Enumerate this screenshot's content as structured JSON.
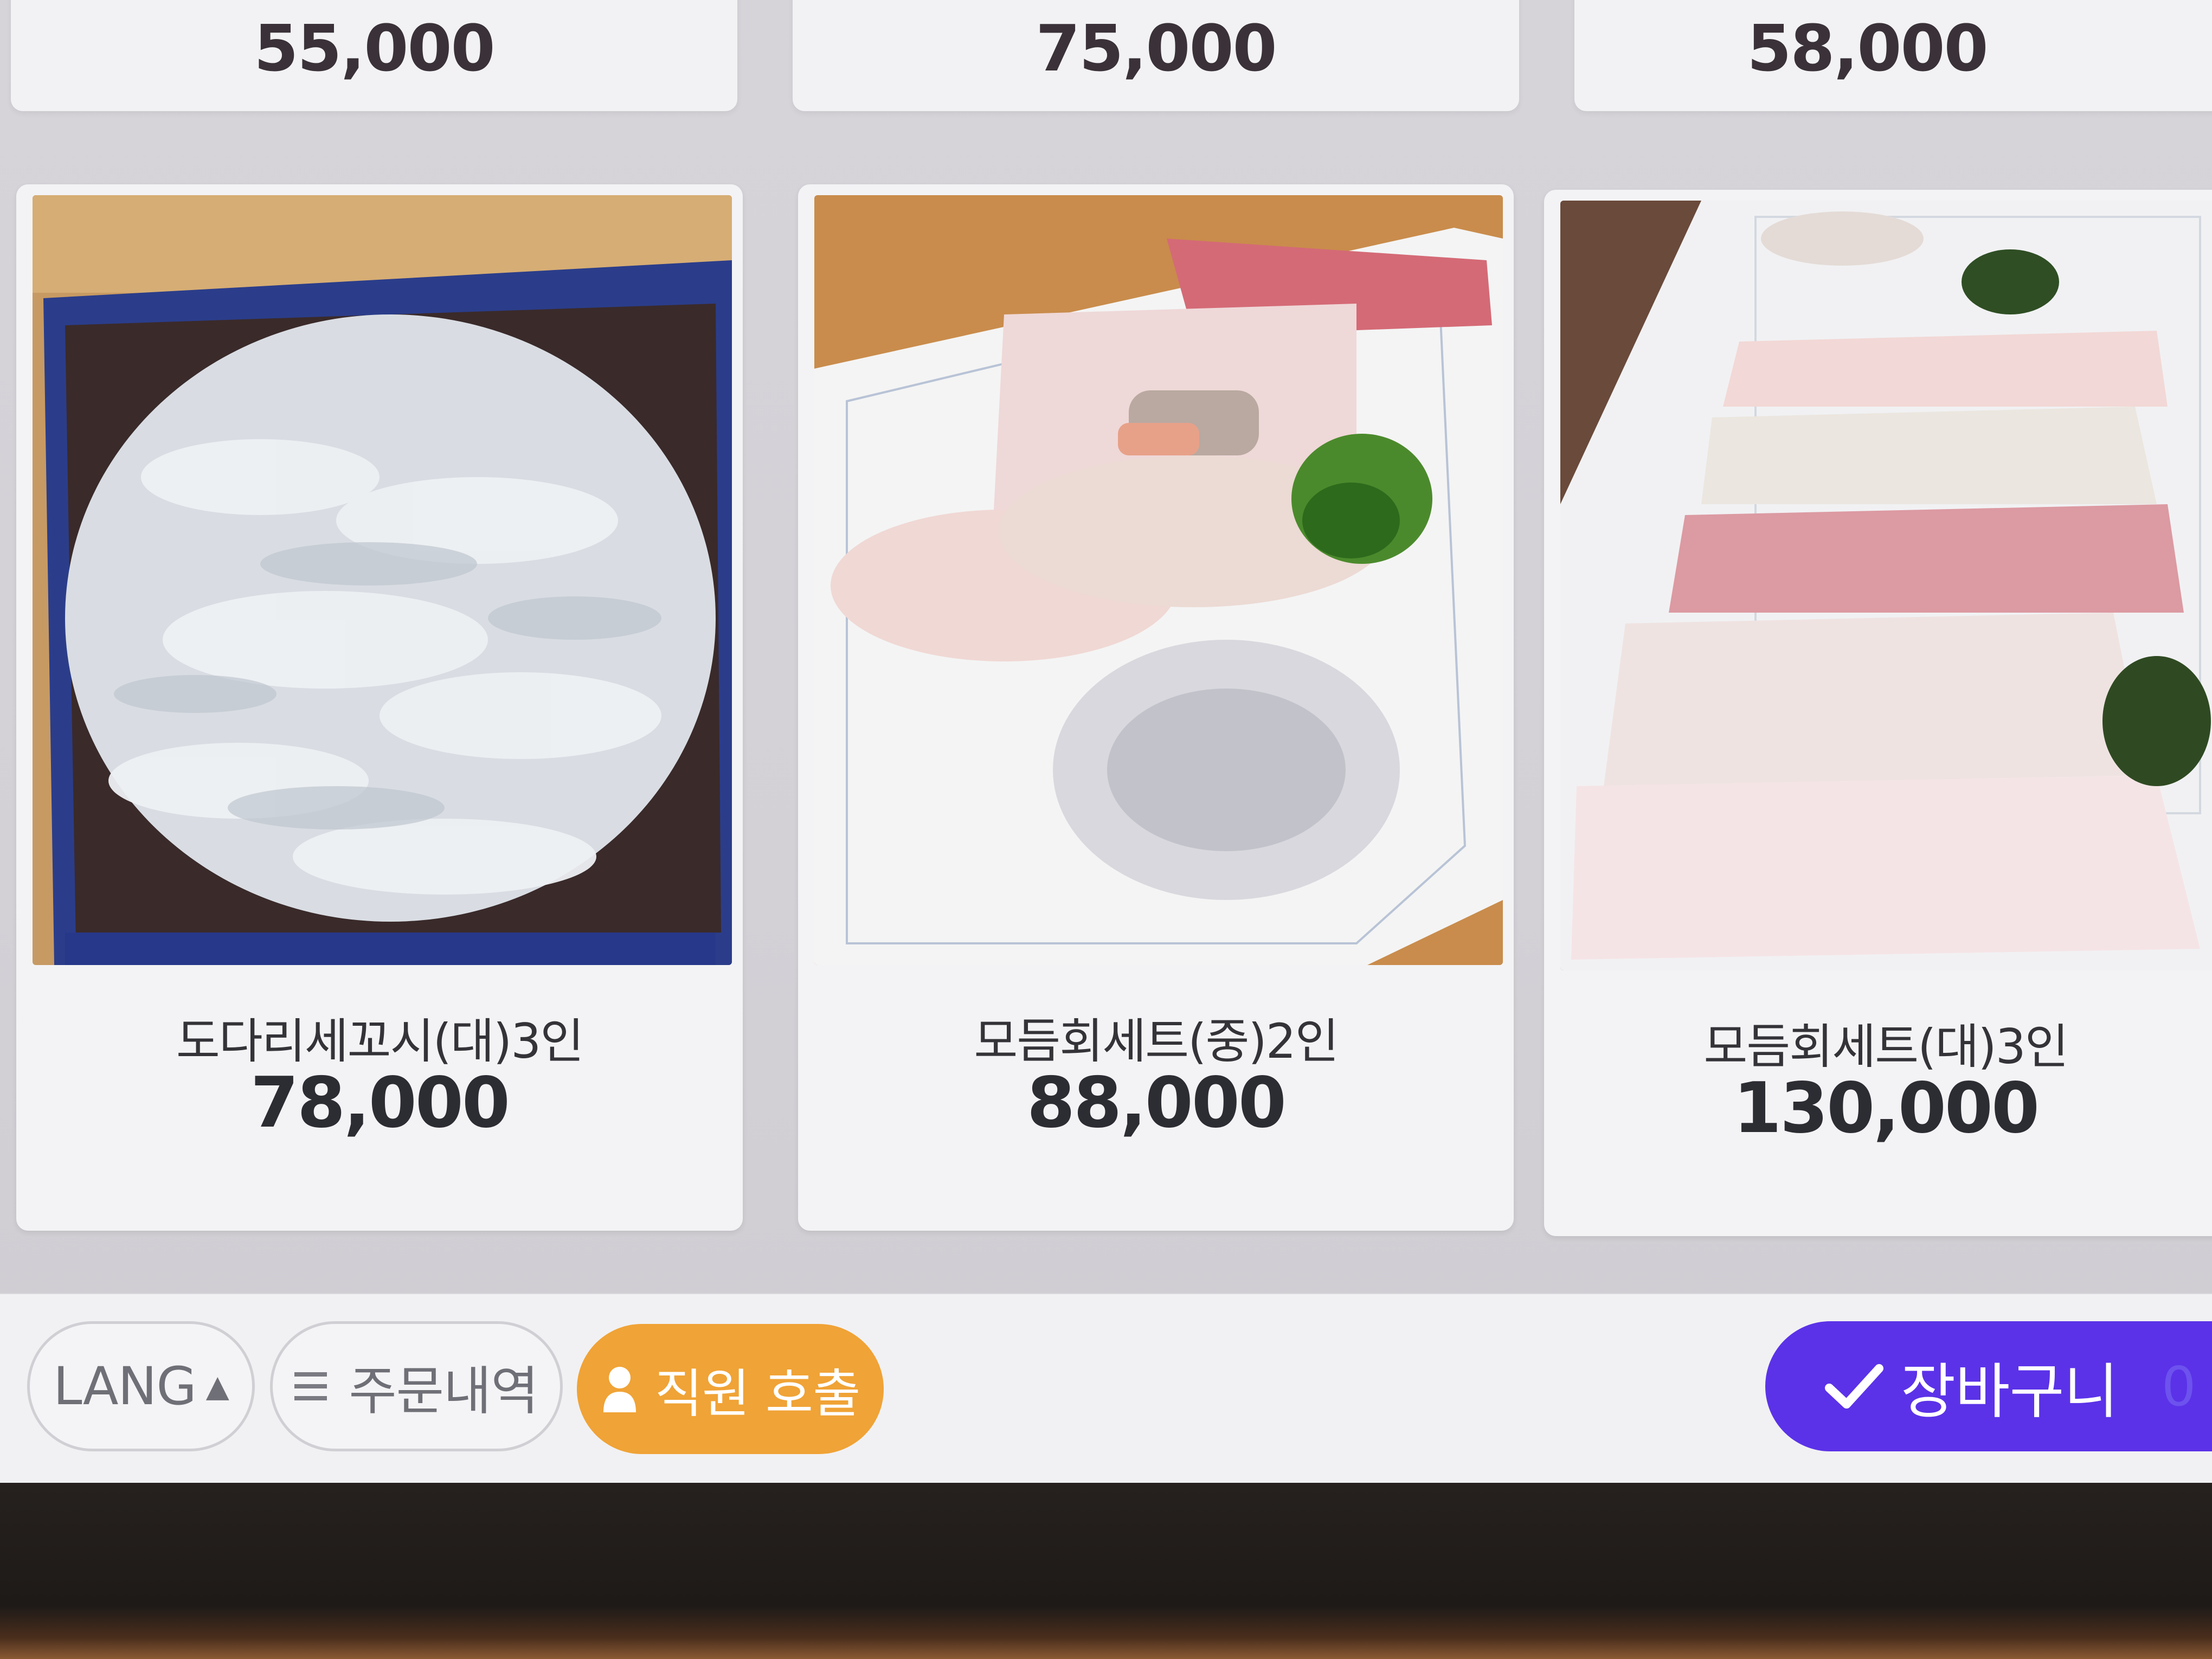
{
  "top_row": {
    "prices": [
      "55,000",
      "75,000",
      "58,000"
    ]
  },
  "menu_items": [
    {
      "name": "도다리세꼬시(대)3인",
      "price": "78,000"
    },
    {
      "name": "모듬회세트(중)2인",
      "price": "88,000"
    },
    {
      "name": "모듬회세트(대)3인",
      "price": "130,000"
    }
  ],
  "bottom_bar": {
    "lang_label": "LANG",
    "order_history_label": "주문내역",
    "call_staff_label": "직원 호출",
    "cart_label": "장바구니",
    "cart_count": "0"
  },
  "colors": {
    "accent_orange": "#f0a336",
    "accent_purple": "#5b32e8",
    "card_bg": "#f3f3f5"
  }
}
